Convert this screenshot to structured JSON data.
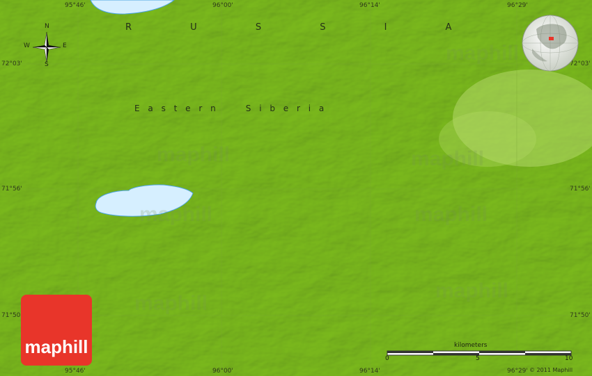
{
  "map": {
    "country_label": "R U S S I A",
    "region_label": "E a s t e r n     S i b e r i a",
    "top_longitudes": [
      "95°46'",
      "96°00'",
      "96°14'",
      "96°29'"
    ],
    "bottom_longitudes": [
      "95°46'",
      "96°00'",
      "96°14'",
      "96°29'"
    ],
    "left_latitudes": [
      "72°03'",
      "71°56'",
      "71°50'"
    ],
    "right_latitudes": [
      "72°03'",
      "71°56'",
      "71°50'"
    ],
    "colors": {
      "land": "#8cc23a",
      "water": "#d6efff",
      "water_outline": "#4aa3df",
      "logo": "#e8352a"
    }
  },
  "compass": {
    "n": "N",
    "s": "S",
    "e": "E",
    "w": "W"
  },
  "logo": {
    "text": "maphill"
  },
  "watermark": {
    "text": "maphill"
  },
  "scale": {
    "title": "kilometers",
    "ticks": [
      "0",
      "5",
      "10"
    ]
  },
  "copyright": "© 2011 Maphill"
}
